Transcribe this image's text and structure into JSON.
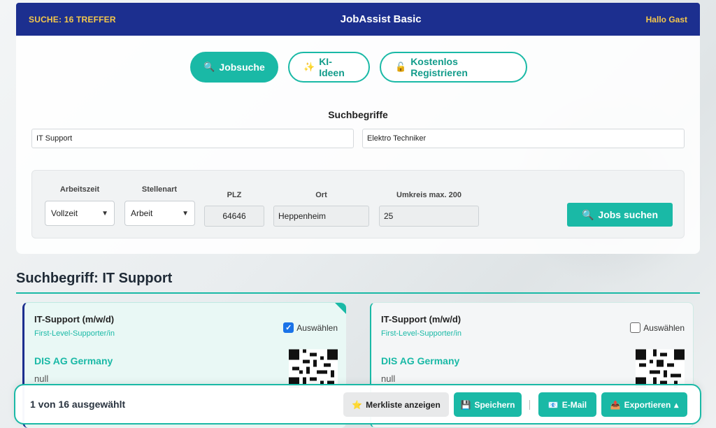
{
  "colors": {
    "accent": "#1ab9a6",
    "header": "#1c2f8f",
    "header_text_accent": "#f5c84a"
  },
  "header": {
    "search_status": "SUCHE: 16 TREFFER",
    "app_title": "JobAssist Basic",
    "greeting": "Hallo Gast"
  },
  "tabs": [
    {
      "label": "Jobsuche",
      "icon": "🔍",
      "active": true
    },
    {
      "label": "KI-Ideen",
      "icon": "✨",
      "active": false
    },
    {
      "label": "Kostenlos Registrieren",
      "icon": "🔓",
      "active": false
    }
  ],
  "search": {
    "section_label": "Suchbegriffe",
    "terms": [
      "IT Support",
      "Elektro Techniker"
    ]
  },
  "filters": {
    "arbeitszeit": {
      "label": "Arbeitszeit",
      "value": "Vollzeit"
    },
    "stellenart": {
      "label": "Stellenart",
      "value": "Arbeit"
    },
    "plz": {
      "label": "PLZ",
      "value": "64646"
    },
    "ort": {
      "label": "Ort",
      "value": "Heppenheim"
    },
    "umkreis": {
      "label": "Umkreis max. 200",
      "value": "25"
    },
    "search_button": "Jobs suchen",
    "search_button_icon": "🔍"
  },
  "results": {
    "heading": "Suchbegriff: IT Support",
    "cards": [
      {
        "title": "IT-Support (m/w/d)",
        "subtitle": "First-Level-Supporter/in",
        "company": "DIS AG Germany",
        "location": "null",
        "select_label": "Auswählen",
        "selected": true
      },
      {
        "title": "IT-Support (m/w/d)",
        "subtitle": "First-Level-Supporter/in",
        "company": "DIS AG Germany",
        "location": "null",
        "select_label": "Auswählen",
        "selected": false
      }
    ]
  },
  "bottombar": {
    "selection_count": "1 von 16 ausgewählt",
    "merkliste": {
      "label": "Merkliste anzeigen",
      "icon": "⭐"
    },
    "save": {
      "label": "Speichern",
      "icon": "💾"
    },
    "email": {
      "label": "E-Mail",
      "icon": "📧"
    },
    "export": {
      "label": "Exportieren",
      "icon": "📤",
      "caret": "▴"
    }
  }
}
